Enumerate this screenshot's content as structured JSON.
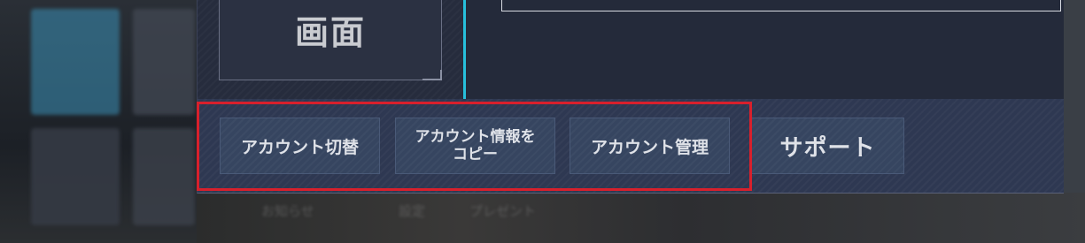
{
  "screen_card": {
    "title": "画面"
  },
  "account_buttons": [
    {
      "label": "アカウント切替"
    },
    {
      "label_line1": "アカウント情報を",
      "label_line2": "コピー"
    },
    {
      "label": "アカウント管理"
    }
  ],
  "support_button": {
    "label": "サポート"
  },
  "background_tabs": [
    "お知らせ",
    "設定",
    "プレゼント"
  ],
  "colors": {
    "highlight": "#d8202c",
    "accent_cyan": "#27c0dc",
    "panel": "#262c3d",
    "button": "#364560"
  }
}
